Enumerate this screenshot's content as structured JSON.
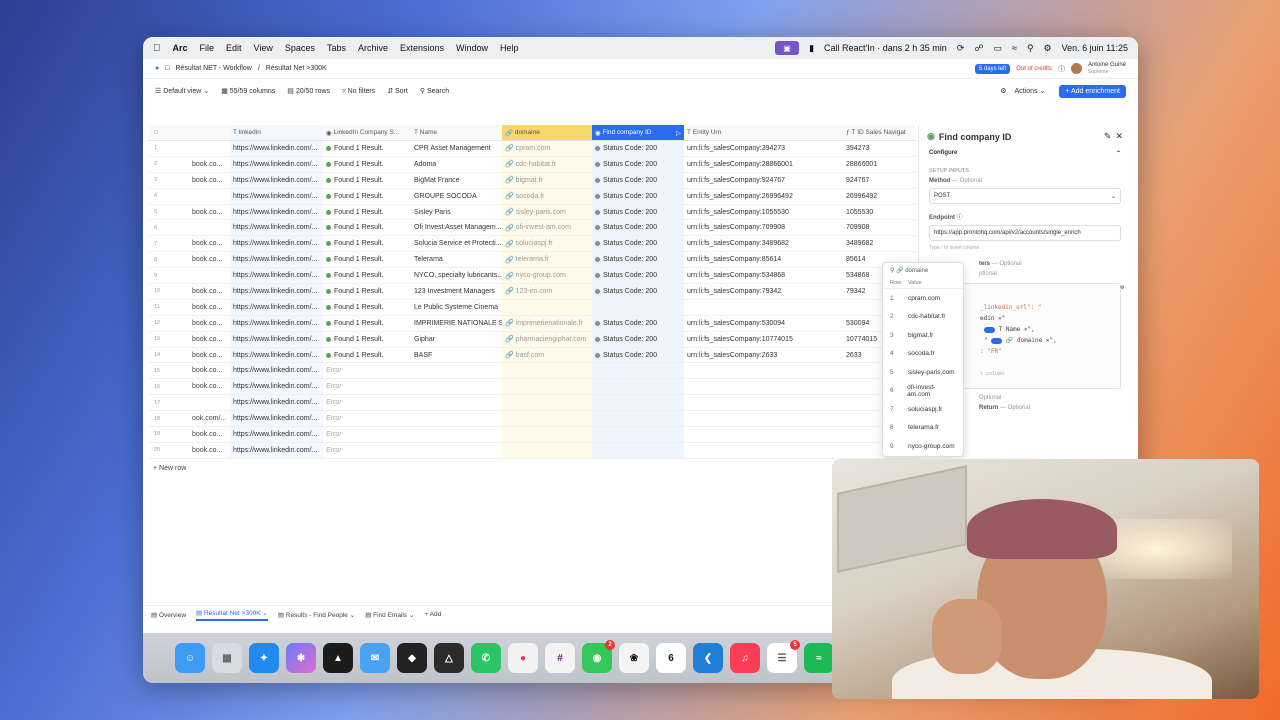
{
  "menubar": {
    "app": "Arc",
    "items": [
      "File",
      "Edit",
      "View",
      "Spaces",
      "Tabs",
      "Archive",
      "Extensions",
      "Window",
      "Help"
    ],
    "meeting": "Call React'In · dans 2 h 35 min",
    "datetime": "Ven. 6 juin 11:25"
  },
  "breadcrumb": {
    "root": "Résultat NET - Workflow",
    "current": "Résultat Net >300K"
  },
  "topbar": {
    "days_left": "5 days left",
    "credits": "Out of credits",
    "user_name": "Antoine Guiné",
    "user_plan": "Supreme"
  },
  "toolbar": {
    "view": "Default view",
    "columns": "55/59 columns",
    "rows": "20/50 rows",
    "filters": "No filters",
    "sort": "Sort",
    "search": "Search",
    "actions": "Actions",
    "add_enrichment": "Add enrichment"
  },
  "table": {
    "headers": [
      "linkedin",
      "LinkedIn Company S...",
      "Name",
      "domaine",
      "Find company ID",
      "Entity Urn",
      "ID Sales Navigat"
    ],
    "rows": [
      {
        "n": "1",
        "pre": "",
        "li": "https://www.linkedin.com/...",
        "f": "Found 1 Result.",
        "name": "CPR Asset Management",
        "dom": "cpram.com",
        "st": "Status Code: 200",
        "urn": "urn:li:fs_salesCompany:394273",
        "id": "394273"
      },
      {
        "n": "2",
        "pre": "book.co...",
        "li": "https://www.linkedin.com/...",
        "f": "Found 1 Result.",
        "name": "Adoma",
        "dom": "cdc-habitat.fr",
        "st": "Status Code: 200",
        "urn": "urn:li:fs_salesCompany:28866001",
        "id": "28866001"
      },
      {
        "n": "3",
        "pre": "book.co...",
        "li": "https://www.linkedin.com/...",
        "f": "Found 1 Result.",
        "name": "BigMat France",
        "dom": "bigmat.fr",
        "st": "Status Code: 200",
        "urn": "urn:li:fs_salesCompany:924767",
        "id": "924767"
      },
      {
        "n": "4",
        "pre": "",
        "li": "https://www.linkedin.com/...",
        "f": "Found 1 Result.",
        "name": "GROUPE SOCODA",
        "dom": "socoda.fr",
        "st": "Status Code: 200",
        "urn": "urn:li:fs_salesCompany:26996492",
        "id": "26996492"
      },
      {
        "n": "5",
        "pre": "book.co...",
        "li": "https://www.linkedin.com/...",
        "f": "Found 1 Result.",
        "name": "Sisley Paris",
        "dom": "sisley-paris.com",
        "st": "Status Code: 200",
        "urn": "urn:li:fs_salesCompany:1055530",
        "id": "1055530"
      },
      {
        "n": "6",
        "pre": "",
        "li": "https://www.linkedin.com/...",
        "f": "Found 1 Result.",
        "name": "Ofi Invest Asset Managem...",
        "dom": "ofi-invest-am.com",
        "st": "Status Code: 200",
        "urn": "urn:li:fs_salesCompany:709908",
        "id": "709908"
      },
      {
        "n": "7",
        "pre": "book.co...",
        "li": "https://www.linkedin.com/...",
        "f": "Found 1 Result.",
        "name": "Solucia Service et Protecti...",
        "dom": "soluciaspj.fr",
        "st": "Status Code: 200",
        "urn": "urn:li:fs_salesCompany:3489682",
        "id": "3489682"
      },
      {
        "n": "8",
        "pre": "book.co...",
        "li": "https://www.linkedin.com/...",
        "f": "Found 1 Result.",
        "name": "Telerama",
        "dom": "telerama.fr",
        "st": "Status Code: 200",
        "urn": "urn:li:fs_salesCompany:85614",
        "id": "85614"
      },
      {
        "n": "9",
        "pre": "",
        "li": "https://www.linkedin.com/...",
        "f": "Found 1 Result.",
        "name": "NYCO, specialty lubricants...",
        "dom": "nyco-group.com",
        "st": "Status Code: 200",
        "urn": "urn:li:fs_salesCompany:534868",
        "id": "534868"
      },
      {
        "n": "10",
        "pre": "book.co...",
        "li": "https://www.linkedin.com/...",
        "f": "Found 1 Result.",
        "name": "123 Investment Managers",
        "dom": "123-im.com",
        "st": "Status Code: 200",
        "urn": "urn:li:fs_salesCompany:79342",
        "id": "79342"
      },
      {
        "n": "11",
        "pre": "book.co...",
        "li": "https://www.linkedin.com/...",
        "f": "Found 1 Result.",
        "name": "Le Public Systeme Cinema",
        "dom": "",
        "st": "",
        "urn": "",
        "id": ""
      },
      {
        "n": "12",
        "pre": "book.co...",
        "li": "https://www.linkedin.com/...",
        "f": "Found 1 Result.",
        "name": "IMPRIMERIE NATIONALE S...",
        "dom": "imprimerienationale.fr",
        "st": "Status Code: 200",
        "urn": "urn:li:fs_salesCompany:530094",
        "id": "530094"
      },
      {
        "n": "13",
        "pre": "book.co...",
        "li": "https://www.linkedin.com/...",
        "f": "Found 1 Result.",
        "name": "Giphar",
        "dom": "pharmaciengiphar.com",
        "st": "Status Code: 200",
        "urn": "urn:li:fs_salesCompany:10774015",
        "id": "10774015"
      },
      {
        "n": "14",
        "pre": "book.co...",
        "li": "https://www.linkedin.com/...",
        "f": "Found 1 Result.",
        "name": "BASF",
        "dom": "basf.com",
        "st": "Status Code: 200",
        "urn": "urn:li:fs_salesCompany:2633",
        "id": "2633"
      },
      {
        "n": "15",
        "pre": "book.co...",
        "li": "https://www.linkedin.com/...",
        "f": "Error",
        "name": "",
        "dom": "",
        "st": "",
        "urn": "",
        "id": ""
      },
      {
        "n": "16",
        "pre": "book.co...",
        "li": "https://www.linkedin.com/...",
        "f": "Error",
        "name": "",
        "dom": "",
        "st": "",
        "urn": "",
        "id": ""
      },
      {
        "n": "17",
        "pre": "",
        "li": "https://www.linkedin.com/...",
        "f": "Error",
        "name": "",
        "dom": "",
        "st": "",
        "urn": "",
        "id": ""
      },
      {
        "n": "18",
        "pre": "ook.com/...",
        "li": "https://www.linkedin.com/...",
        "f": "Error",
        "name": "",
        "dom": "",
        "st": "",
        "urn": "",
        "id": ""
      },
      {
        "n": "19",
        "pre": "book.co...",
        "li": "https://www.linkedin.com/...",
        "f": "Error",
        "name": "",
        "dom": "",
        "st": "",
        "urn": "",
        "id": ""
      },
      {
        "n": "20",
        "pre": "book.co...",
        "li": "https://www.linkedin.com/...",
        "f": "Error",
        "name": "",
        "dom": "",
        "st": "",
        "urn": "",
        "id": ""
      }
    ],
    "new_row": "New row"
  },
  "panel": {
    "title": "Find company ID",
    "configure": "Configure",
    "setup_inputs": "SETUP INPUTS",
    "method_label": "Method",
    "optional": "— Optional",
    "method_value": "POST",
    "endpoint_label": "Endpoint",
    "endpoint_value": "https://app.prontohq.com/api/v2/accounts/single_enrich",
    "insert_hint": "Type / to insert column",
    "params_label": "ters",
    "params_optional": "— Optional",
    "optional2": "ptional",
    "code_line1": "_linkedin_url\": \"",
    "code_line2": "edin",
    "code_name": "Name",
    "code_domaine": "domaine",
    "code_fr": ": \"FR\"",
    "code_hint": "t column",
    "optional3": "Optional",
    "return_label": "Return",
    "return_optional": "— Optional"
  },
  "dropdown": {
    "title": "domaine",
    "col_row": "Row",
    "col_value": "Value",
    "items": [
      {
        "n": "1",
        "v": "cpram.com"
      },
      {
        "n": "2",
        "v": "cdc-habitat.fr"
      },
      {
        "n": "3",
        "v": "bigmat.fr"
      },
      {
        "n": "4",
        "v": "socoda.fr"
      },
      {
        "n": "5",
        "v": "sisley-paris.com"
      },
      {
        "n": "6",
        "v": "ofi-invest-am.com"
      },
      {
        "n": "7",
        "v": "soluciaspj.fr"
      },
      {
        "n": "8",
        "v": "telerama.fr"
      },
      {
        "n": "9",
        "v": "nyco-group.com"
      }
    ]
  },
  "sheet_tabs": [
    "Overview",
    "Résultat Net >300K",
    "Results - Find People",
    "Find Emails"
  ],
  "add_tab": "Add",
  "dock": {
    "apps": [
      "Finder",
      "Launchpad",
      "Safari",
      "Copilot",
      "Reeder",
      "Mail",
      "Raycast",
      "Notchmeister",
      "WhatsApp",
      "Craft",
      "Slack",
      "Messages",
      "ChatGPT",
      "Calendar",
      "VS Code",
      "Music",
      "Reminders",
      "Spotify"
    ],
    "calendar_day": "6",
    "badge_messages": "2",
    "badge_reminders": "5"
  },
  "colors": {
    "accent": "#2a6bf0",
    "domain_header": "#f6d86c",
    "ok": "#5aa35a"
  }
}
